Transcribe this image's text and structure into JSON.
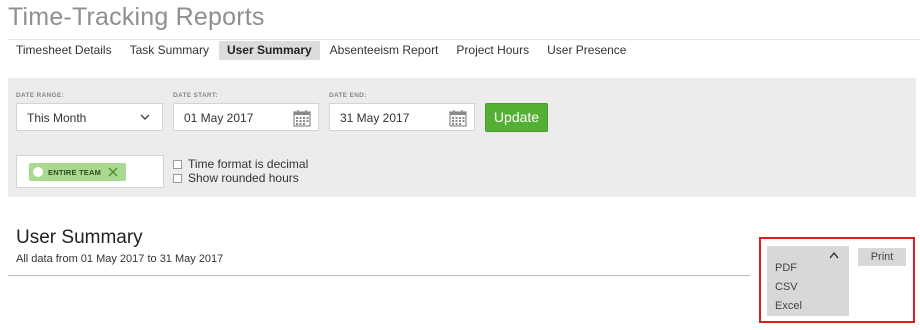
{
  "page": {
    "title": "Time-Tracking Reports"
  },
  "tabs": [
    {
      "label": "Timesheet Details",
      "active": false
    },
    {
      "label": "Task Summary",
      "active": false
    },
    {
      "label": "User Summary",
      "active": true
    },
    {
      "label": "Absenteeism Report",
      "active": false
    },
    {
      "label": "Project Hours",
      "active": false
    },
    {
      "label": "User Presence",
      "active": false
    }
  ],
  "filters": {
    "date_range": {
      "label": "DATE RANGE:",
      "value": "This Month"
    },
    "date_start": {
      "label": "DATE START:",
      "value": "01 May 2017"
    },
    "date_end": {
      "label": "DATE END:",
      "value": "31 May 2017"
    },
    "update_label": "Update",
    "team": {
      "label": "ENTIRE TEAM"
    },
    "options": {
      "decimal_label": "Time format is decimal",
      "rounded_label": "Show rounded hours"
    }
  },
  "summary": {
    "title": "User Summary",
    "subtitle": "All data from 01 May 2017 to 31 May 2017"
  },
  "export": {
    "items": [
      "PDF",
      "CSV",
      "Excel"
    ],
    "print_label": "Print"
  },
  "colors": {
    "accent_green": "#54b034",
    "team_pill": "#a8d98e",
    "highlight": "#e31b1b",
    "panel_bg": "#ececec"
  }
}
